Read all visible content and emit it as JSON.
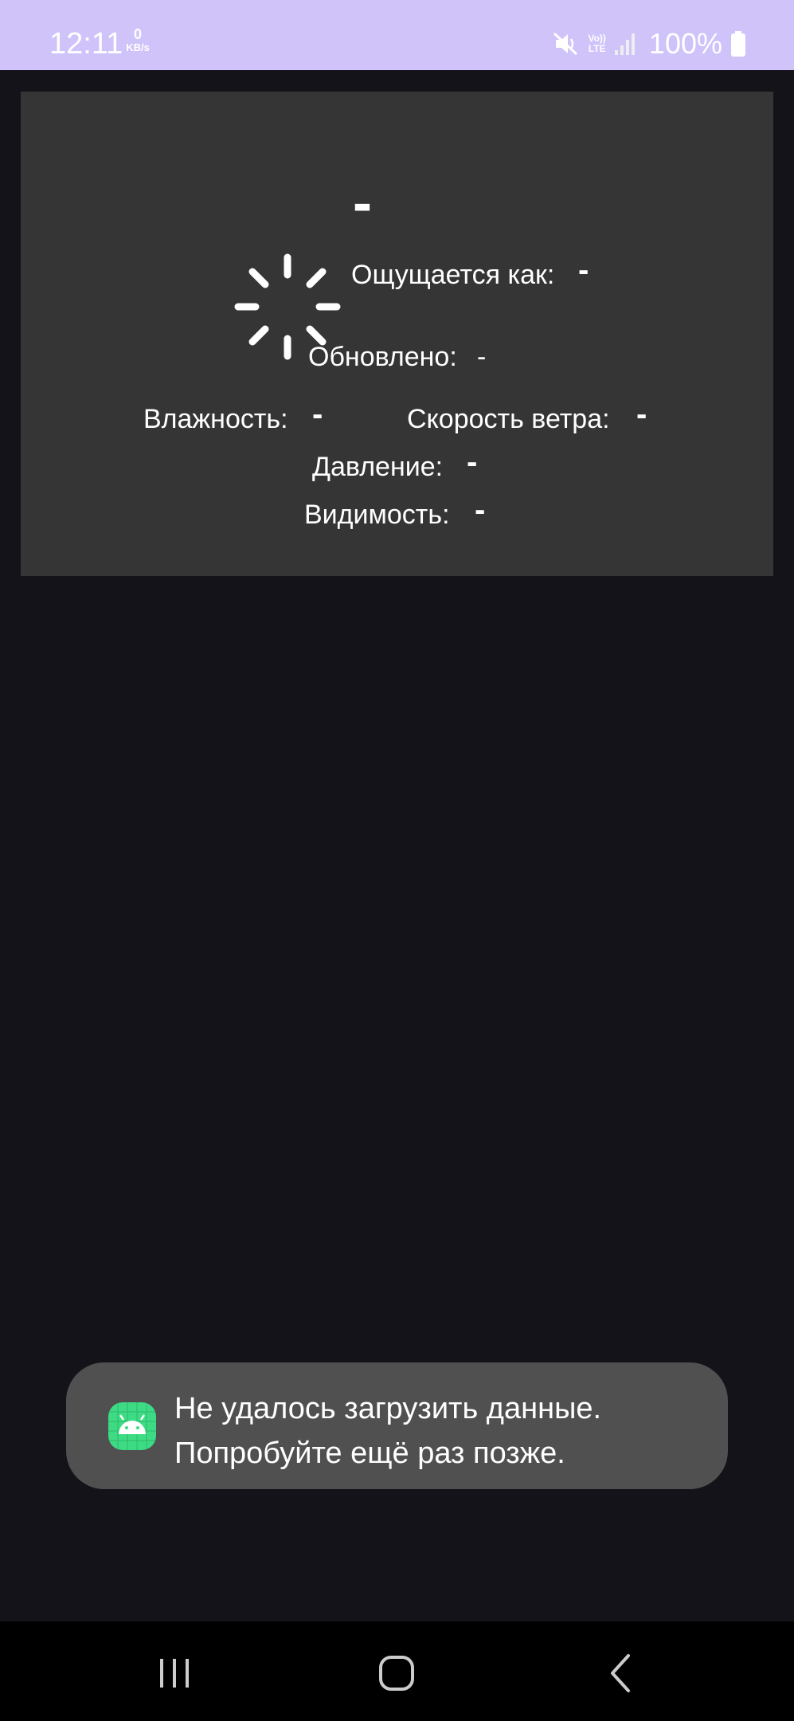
{
  "status_bar": {
    "time": "12:11",
    "net_speed_value": "0",
    "net_speed_unit": "KB/s",
    "volte_line1": "Vo))",
    "volte_line2": "LTE",
    "battery_percent": "100%",
    "icons": [
      "mute-icon",
      "volte-icon",
      "signal-icon",
      "battery-icon"
    ]
  },
  "weather": {
    "temperature": "-",
    "feels_like_label": "Ощущается как:",
    "feels_like_value": "-",
    "updated_label": "Обновлено:",
    "updated_value": "-",
    "humidity_label": "Влажность:",
    "humidity_value": "-",
    "wind_label": "Скорость ветра:",
    "wind_value": "-",
    "pressure_label": "Давление:",
    "pressure_value": "-",
    "visibility_label": "Видимость:",
    "visibility_value": "-",
    "icon": "loading-spinner-icon"
  },
  "toast": {
    "line1": "Не удалось загрузить данные.",
    "line2": "Попробуйте ещё раз позже.",
    "icon": "android-app-icon"
  },
  "nav_bar": {
    "buttons": [
      "recent-apps-icon",
      "home-icon",
      "back-icon"
    ]
  },
  "colors": {
    "status_bar_bg": "#cfc3fa",
    "screen_bg": "#15131a",
    "card_bg": "#353535",
    "toast_bg": "#505050",
    "android_green": "#3ddc84"
  }
}
